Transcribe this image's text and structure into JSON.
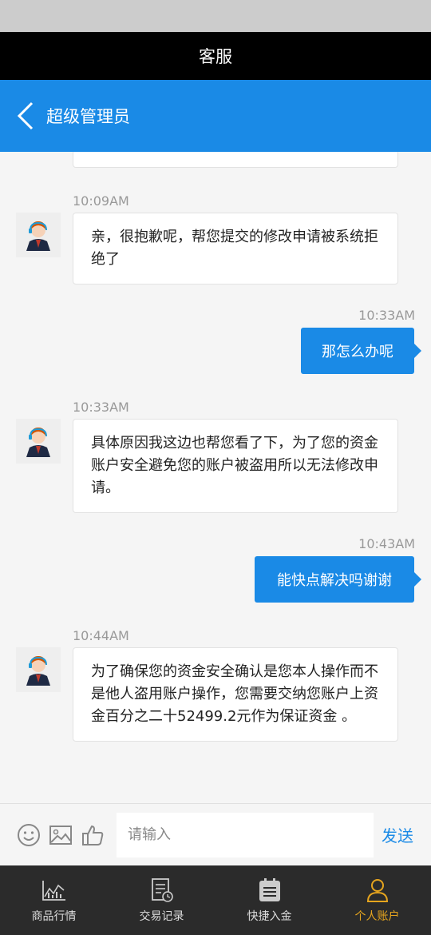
{
  "title_bar": {
    "title": "客服"
  },
  "nav": {
    "title": "超级管理员"
  },
  "messages": [
    {
      "side": "left",
      "time": "10:09AM",
      "text": "亲，很抱歉呢，帮您提交的修改申请被系统拒绝了"
    },
    {
      "side": "right",
      "time": "10:33AM",
      "text": "那怎么办呢"
    },
    {
      "side": "left",
      "time": "10:33AM",
      "text": "具体原因我这边也帮您看了下，为了您的资金账户安全避免您的账户被盗用所以无法修改申请。"
    },
    {
      "side": "right",
      "time": "10:43AM",
      "text": "能快点解决吗谢谢"
    },
    {
      "side": "left",
      "time": "10:44AM",
      "text": "为了确保您的资金安全确认是您本人操作而不是他人盗用账户操作，您需要交纳您账户上资金百分之二十52499.2元作为保证资金 。"
    }
  ],
  "input_bar": {
    "placeholder": "请输入",
    "send_label": "发送",
    "tools": [
      "smiley-icon",
      "image-icon",
      "thumbs-up-icon"
    ]
  },
  "tabs": [
    {
      "label": "商品行情",
      "icon": "chart-icon",
      "active": false
    },
    {
      "label": "交易记录",
      "icon": "record-icon",
      "active": false
    },
    {
      "label": "快捷入金",
      "icon": "deposit-icon",
      "active": false
    },
    {
      "label": "个人账户",
      "icon": "user-icon",
      "active": true
    }
  ],
  "colors": {
    "accent": "#1a8ae6",
    "title_bar": "#000000",
    "tab_bar": "#2b2b2b",
    "active_tab": "#e6a51e"
  }
}
